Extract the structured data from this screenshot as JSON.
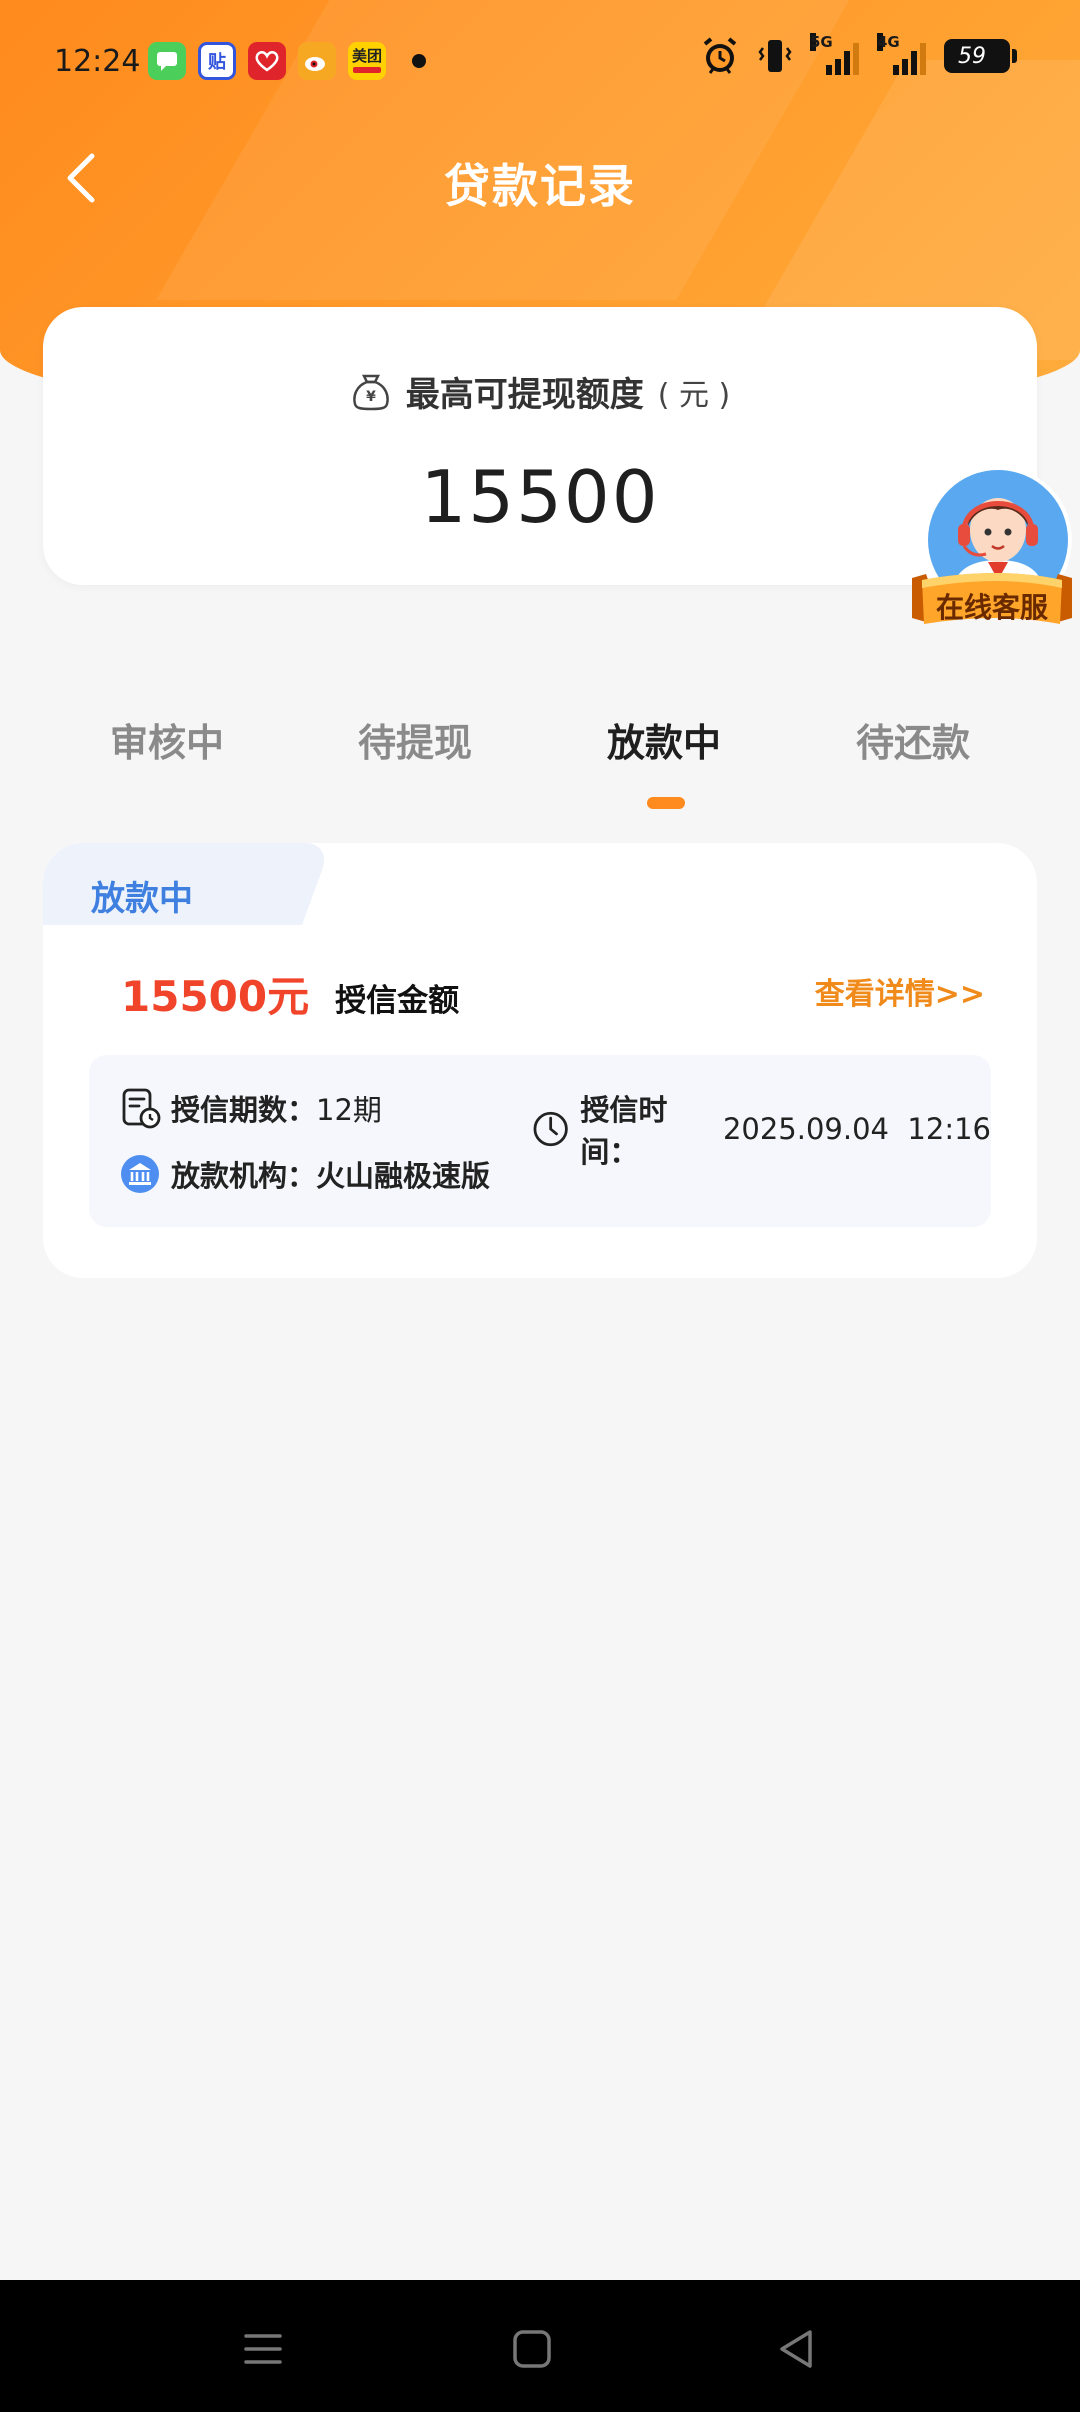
{
  "status_bar": {
    "time": "12:24",
    "apps": [
      "messages-app",
      "tieba-app",
      "taobao-app",
      "weibo-app",
      "meituan-app"
    ],
    "meituan_label": "美团",
    "tieba_label": "贴",
    "signal_1": "5G",
    "signal_2": "4G",
    "battery": "59"
  },
  "header": {
    "title": "贷款记录"
  },
  "limit_card": {
    "label": "最高可提现额度",
    "unit": "( 元 )",
    "amount": "15500"
  },
  "customer_service": {
    "label": "在线客服"
  },
  "tabs": [
    {
      "label": "审核中",
      "active": false
    },
    {
      "label": "待提现",
      "active": false
    },
    {
      "label": "放款中",
      "active": true
    },
    {
      "label": "待还款",
      "active": false
    }
  ],
  "record": {
    "status": "放款中",
    "amount": "15500元",
    "amount_label": "授信金额",
    "detail_link": "查看详情>>",
    "periods_label": "授信期数：",
    "periods_value": "12期",
    "time_label": "授信时间：",
    "time_value": "2025.09.04  12:16",
    "institution_label": "放款机构：",
    "institution_value": "火山融极速版"
  },
  "colors": {
    "header_orange": "#ff8a1d",
    "accent_orange": "#f08a1a",
    "amount_red": "#f0452a",
    "status_blue": "#3f7fe0"
  }
}
